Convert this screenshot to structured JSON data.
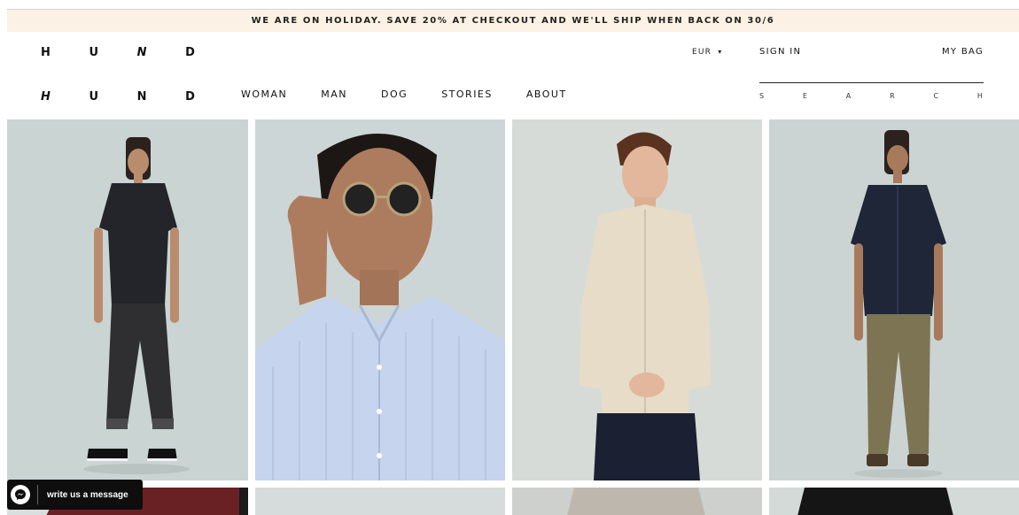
{
  "promo_banner": {
    "text": "WE ARE ON HOLIDAY. SAVE 20% AT CHECKOUT AND WE'LL SHIP WHEN BACK ON 30/6"
  },
  "logo": {
    "row1": [
      "H",
      "U",
      "N",
      "D"
    ],
    "row2": [
      "H",
      "U",
      "N",
      "D"
    ]
  },
  "nav": {
    "items": [
      {
        "label": "WOMAN"
      },
      {
        "label": "MAN"
      },
      {
        "label": "DOG"
      },
      {
        "label": "STORIES"
      },
      {
        "label": "ABOUT"
      }
    ]
  },
  "header": {
    "currency_label": "EUR",
    "currency_caret": "▾",
    "sign_in_label": "SIGN IN",
    "bag_label": "MY BAG"
  },
  "search": {
    "letters": [
      "S",
      "E",
      "A",
      "R",
      "C",
      "H"
    ]
  },
  "products": {
    "items": [
      {
        "kind": "full",
        "shirt": "#23252b",
        "pants": "#2f2f31",
        "shoes": "#111111",
        "background": "#c9d4d3"
      },
      {
        "kind": "portrait",
        "shirt": "#c6d4ee",
        "background": "#cdd6d6"
      },
      {
        "kind": "half",
        "shirt": "#e6dcc8",
        "pants": "#1b2033",
        "background": "#d7dbd8"
      },
      {
        "kind": "full",
        "shirt": "#1e2638",
        "pants": "#7d7454",
        "shoes": "#4a3a2a",
        "background": "#cbd4d2"
      }
    ],
    "peek_colors": [
      "#6a2124",
      "#d5dcdb",
      "#cdd0cc",
      "#151515"
    ]
  },
  "messenger": {
    "label": "write us a message"
  },
  "colors": {
    "promo_bg": "#fbf1e4",
    "text": "#111111",
    "messenger_bg": "#0e0e0e"
  }
}
